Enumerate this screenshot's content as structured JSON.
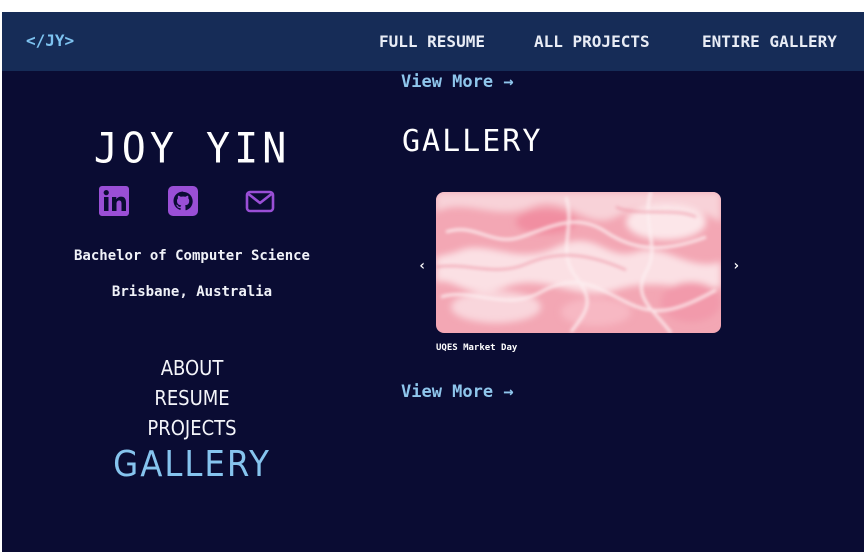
{
  "header": {
    "logo": "</JY>",
    "nav": [
      "FULL RESUME",
      "ALL PROJECTS",
      "ENTIRE GALLERY"
    ]
  },
  "profile": {
    "name": "JOY YIN",
    "socials": [
      {
        "icon": "linkedin-icon",
        "color": "#9a4fd6"
      },
      {
        "icon": "github-icon",
        "color": "#9a4fd6"
      },
      {
        "icon": "mail-icon",
        "color": "#9a4fd6"
      }
    ],
    "degree": "Bachelor of Computer Science",
    "location": "Brisbane, Australia"
  },
  "side_nav": [
    {
      "label": "ABOUT",
      "active": false
    },
    {
      "label": "RESUME",
      "active": false
    },
    {
      "label": "PROJECTS",
      "active": false
    },
    {
      "label": "GALLERY",
      "active": true
    }
  ],
  "main": {
    "view_more_top": "View More →",
    "section_title": "GALLERY",
    "carousel": {
      "prev": "‹",
      "next": "›",
      "caption": "UQES Market Day"
    },
    "view_more_bottom": "View More →"
  },
  "colors": {
    "background": "#0a0c33",
    "header": "#162c57",
    "accent": "#86c4ee",
    "social": "#9a4fd6"
  }
}
